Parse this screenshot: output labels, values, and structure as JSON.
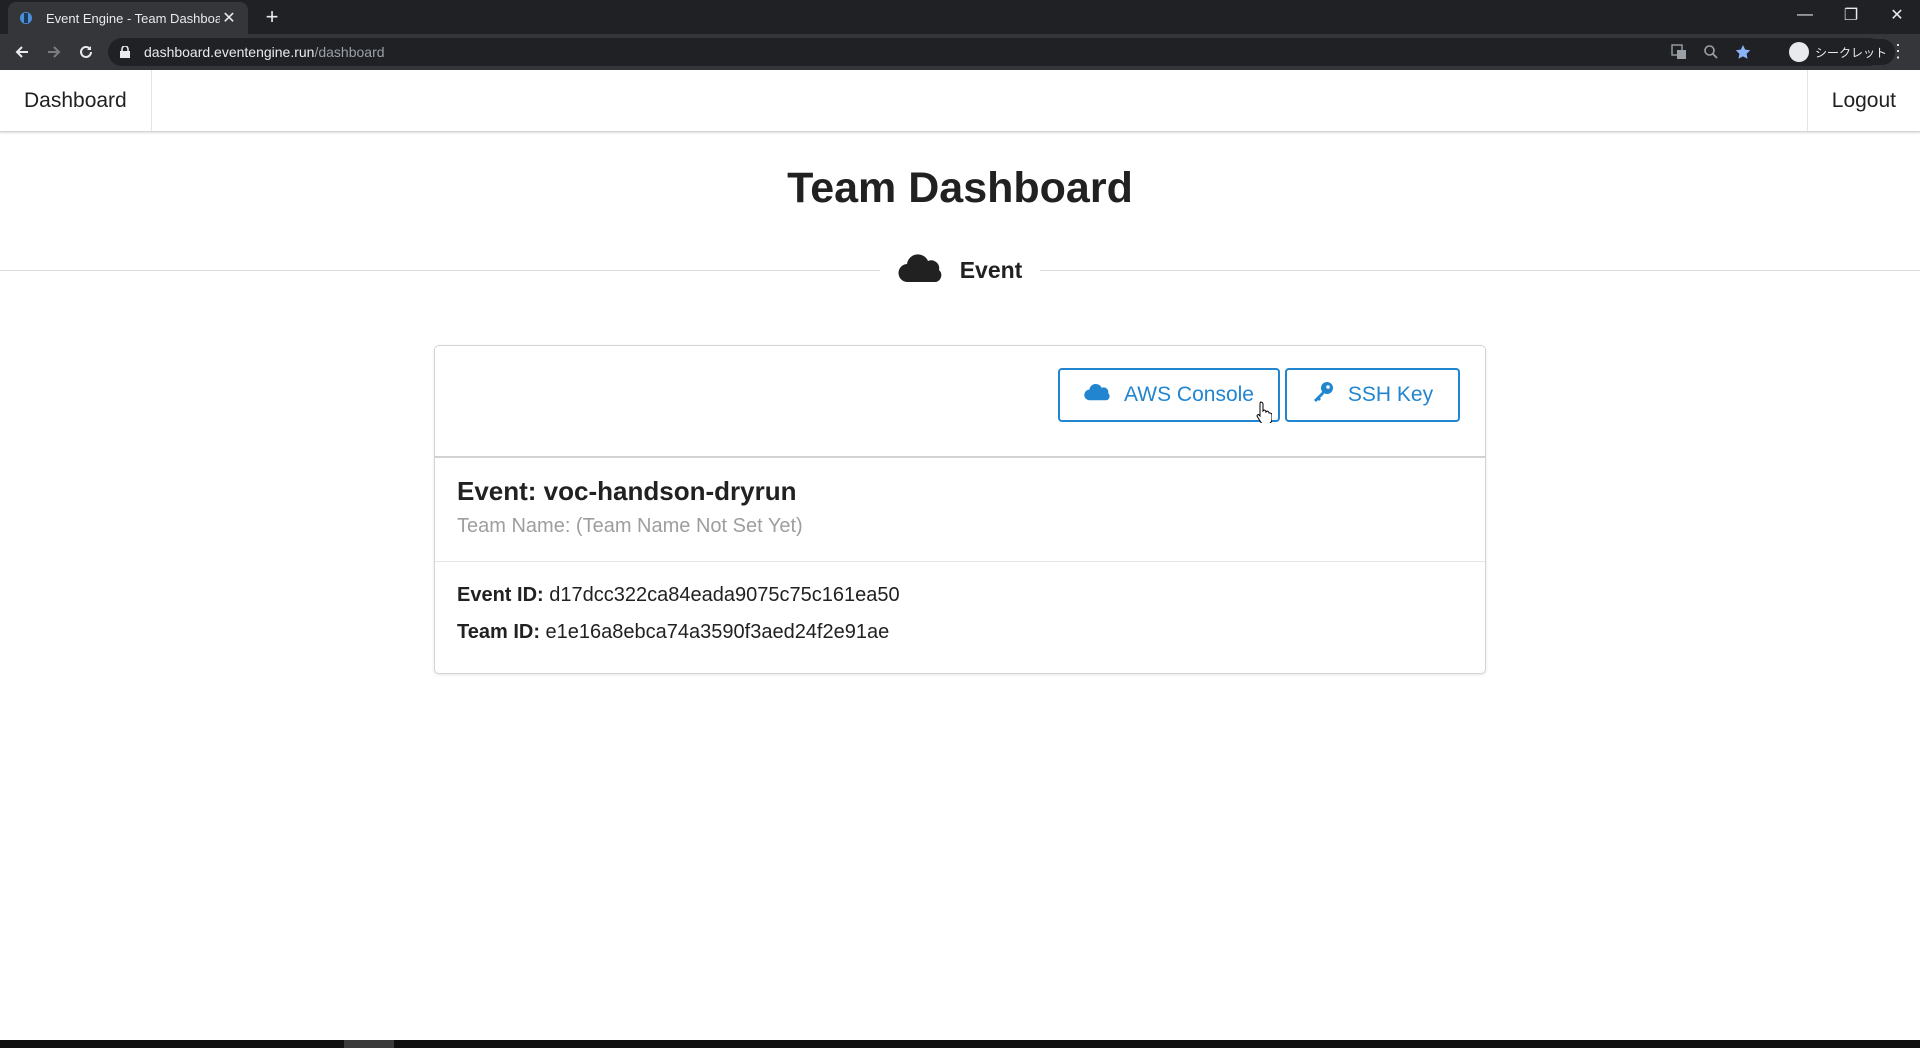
{
  "browser": {
    "tab_title": "Event Engine - Team Dashboard",
    "tab_close": "✕",
    "new_tab": "+",
    "url_host": "dashboard.eventengine.run",
    "url_path": "/dashboard",
    "profile_label": "シークレット",
    "menu": "⋮",
    "window_controls": {
      "minimize": "—",
      "restore": "❐",
      "close": "✕"
    }
  },
  "nav": {
    "left_label": "Dashboard",
    "right_label": "Logout"
  },
  "page": {
    "title": "Team Dashboard",
    "section_label": "Event"
  },
  "actions": {
    "aws_console_label": "AWS Console",
    "ssh_key_label": "SSH Key"
  },
  "event": {
    "name": "Event: voc-handson-dryrun",
    "team_name": "Team Name: (Team Name Not Set Yet)",
    "event_id_label": "Event ID:",
    "event_id_value": "d17dcc322ca84eada9075c75c161ea50",
    "team_id_label": "Team ID:",
    "team_id_value": "e1e16a8ebca74a3590f3aed24f2e91ae"
  },
  "colors": {
    "primary": "#2185d0",
    "chrome_dark": "#202124",
    "chrome_toolbar": "#35363a",
    "muted_text": "#9e9e9e"
  },
  "icons": [
    "favicon-icon",
    "close-icon",
    "plus-icon",
    "back-icon",
    "forward-icon",
    "reload-icon",
    "lock-icon",
    "translate-icon",
    "zoom-icon",
    "star-icon",
    "incognito-icon",
    "cloud-icon",
    "key-icon",
    "pointer-cursor-icon"
  ]
}
